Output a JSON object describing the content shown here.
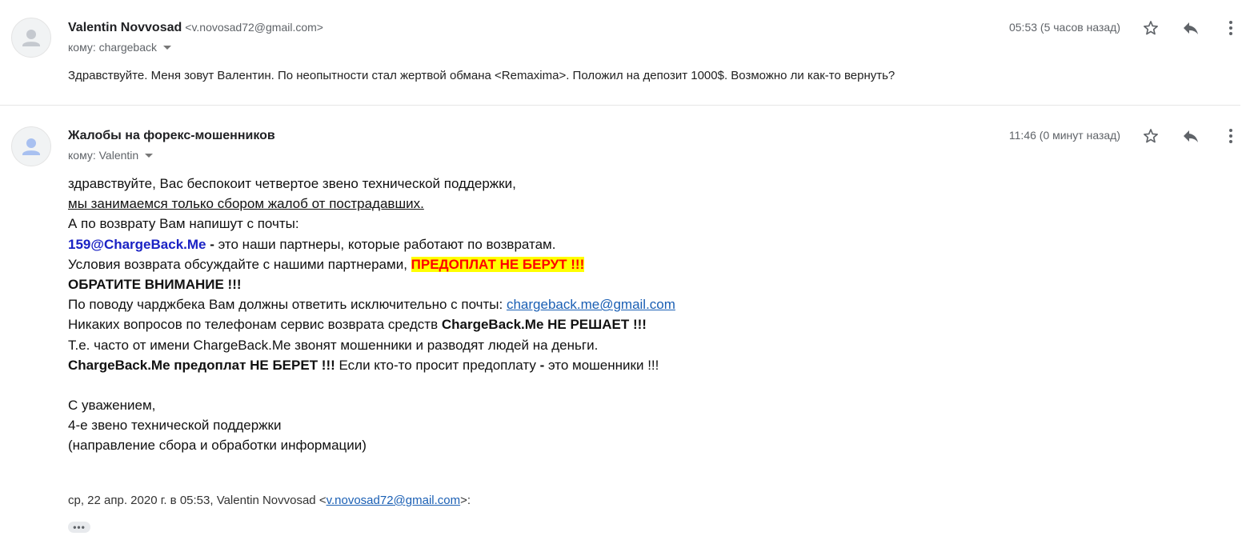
{
  "messages": [
    {
      "sender_name": "Valentin Novvosad",
      "sender_email": "<v.novosad72@gmail.com>",
      "recipient": "кому: chargeback",
      "time": "05:53 (5 часов назад)",
      "preview": "Здравствуйте. Меня зовут Валентин. По неопытности стал жертвой обмана <Remaxima>. Положил на депозит 1000$. Возможно ли как-то вернуть?"
    },
    {
      "sender_name": "Жалобы на форекс-мошенников",
      "recipient": "кому: Valentin",
      "time": "11:46 (0 минут назад)",
      "body": {
        "line1": "здравствуйте, Вас беспокоит четвертое звено технической поддержки,",
        "line2": "мы занимаемся только сбором жалоб от пострадавших.",
        "line3": "А по возврату Вам напишут с почты:",
        "line4_email": "159@ChargeBack.Me",
        "line4_dash": " - ",
        "line4_rest": "это наши партнеры, которые работают по возвратам.",
        "line5_text": "Условия возврата обсуждайте с нашими партнерами, ",
        "line5_highlight": "ПРЕДОПЛАТ НЕ БЕРУТ !!!",
        "line6": "ОБРАТИТЕ ВНИМАНИЕ !!!",
        "line7_text": "По поводу чарджбека Вам должны ответить исключительно с почты: ",
        "line7_link": "chargeback.me@gmail.com",
        "line8_text": "Никаких вопросов по телефонам сервис возврата средств ",
        "line8_bold": "ChargeBack.Me НЕ РЕШАЕТ !!!",
        "line9": "Т.е. часто от имени ChargeBack.Me звонят мошенники и разводят людей на деньги.",
        "line10_bold": "ChargeBack.Me предоплат НЕ БЕРЕТ !!!",
        "line10_text": " Если кто-то просит предоплату ",
        "line10_dash": "-",
        "line10_rest": " это мошенники !!!",
        "sig1": "С уважением,",
        "sig2": "4-е звено технической поддержки",
        "sig3": "(направление сбора и обработки информации)"
      },
      "quote_prefix": "ср, 22 апр. 2020 г. в 05:53, Valentin Novvosad <",
      "quote_email": "v.novosad72@gmail.com",
      "quote_suffix": ">:",
      "ellipsis_label": "•••"
    }
  ],
  "icons": {
    "star": "star-icon",
    "reply": "reply-icon",
    "more": "more-vert-icon",
    "avatar": "person-icon"
  },
  "colors": {
    "link": "#1a5fb4",
    "email_blue": "#1a22c4",
    "highlight_bg": "#ffff00",
    "highlight_text": "#ff0000"
  }
}
